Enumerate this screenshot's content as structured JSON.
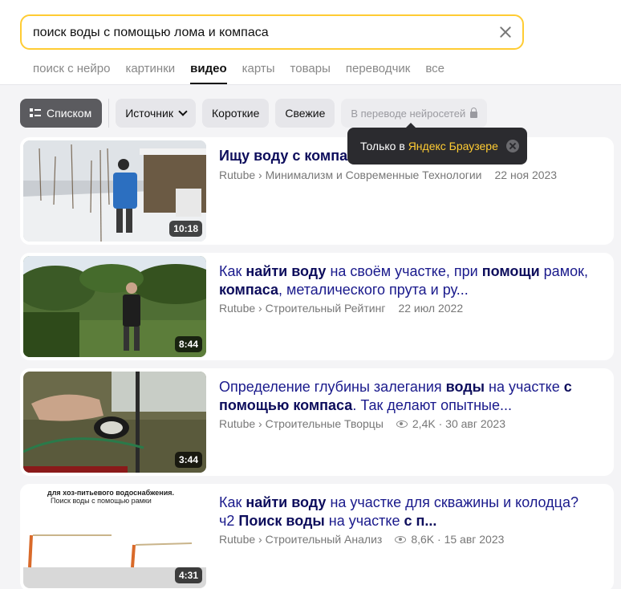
{
  "search": {
    "query": "поиск воды с помощью лома и компаса"
  },
  "tabs": [
    "поиск с нейро",
    "картинки",
    "видео",
    "карты",
    "товары",
    "переводчик",
    "все"
  ],
  "active_tab": "видео",
  "filters": {
    "list_view": "Списком",
    "source": "Источник",
    "short": "Короткие",
    "fresh": "Свежие",
    "neural_translation": "В переводе нейросетей"
  },
  "tooltip": {
    "text": "Только в ",
    "link": "Яндекс Браузере"
  },
  "results": [
    {
      "title_parts": [
        {
          "t": "Ищу воду с компас",
          "b": true
        }
      ],
      "source": "Rutube › Минимализм и Современные Технологии",
      "views": "",
      "date": "22 ноя 2023",
      "duration": "10:18"
    },
    {
      "title_parts": [
        {
          "t": "Как ",
          "b": false
        },
        {
          "t": "найти воду",
          "b": true
        },
        {
          "t": " на своём участке, при ",
          "b": false
        },
        {
          "t": "помощи",
          "b": true
        },
        {
          "t": " рамок, ",
          "b": false
        },
        {
          "t": "компаса",
          "b": true
        },
        {
          "t": ", металического прута и ру...",
          "b": false
        }
      ],
      "source": "Rutube › Строительный Рейтинг",
      "views": "",
      "date": "22 июл 2022",
      "duration": "8:44"
    },
    {
      "title_parts": [
        {
          "t": "Определение глубины залегания ",
          "b": false
        },
        {
          "t": "воды",
          "b": true
        },
        {
          "t": " на участке ",
          "b": false
        },
        {
          "t": "с помощью компаса",
          "b": true
        },
        {
          "t": ". Так делают опытные...",
          "b": false
        }
      ],
      "source": "Rutube › Строительные Творцы",
      "views": "2,4K",
      "date": "30 авг 2023",
      "duration": "3:44"
    },
    {
      "title_parts": [
        {
          "t": "Как ",
          "b": false
        },
        {
          "t": "найти воду",
          "b": true
        },
        {
          "t": " на участке для скважины и колодца? ч2 ",
          "b": false
        },
        {
          "t": "Поиск воды",
          "b": true
        },
        {
          "t": " на участке ",
          "b": false
        },
        {
          "t": "с п...",
          "b": true
        }
      ],
      "source": "Rutube › Строительный Анализ",
      "views": "8,6K",
      "date": "15 авг 2023",
      "duration": "4:31",
      "thumb_caption_1": "для хоз-питьевого водоснабжения.",
      "thumb_caption_2": "Поиск воды с помощью рамки"
    }
  ]
}
